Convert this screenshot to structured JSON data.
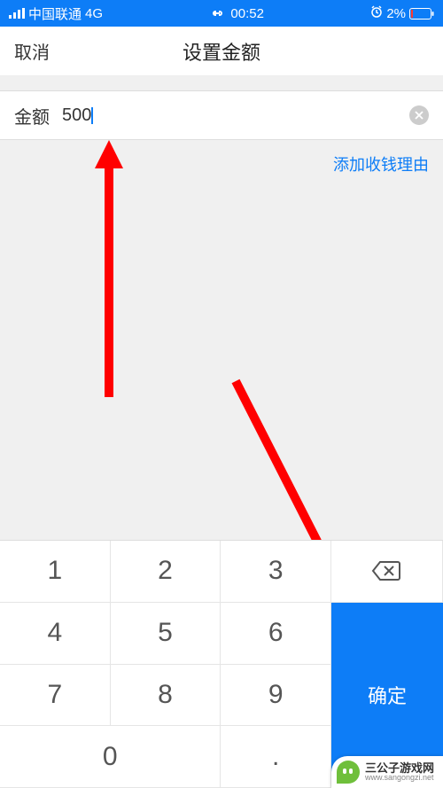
{
  "statusBar": {
    "carrier": "中国联通",
    "network": "4G",
    "time": "00:52",
    "batteryPercent": "2%"
  },
  "header": {
    "cancel": "取消",
    "title": "设置金额"
  },
  "amount": {
    "label": "金额",
    "value": "500"
  },
  "addReason": "添加收钱理由",
  "keypad": {
    "k1": "1",
    "k2": "2",
    "k3": "3",
    "k4": "4",
    "k5": "5",
    "k6": "6",
    "k7": "7",
    "k8": "8",
    "k9": "9",
    "k0": "0",
    "dot": ".",
    "confirm": "确定"
  },
  "watermark": {
    "title": "三公子游戏网",
    "url": "www.sangongzi.net"
  }
}
